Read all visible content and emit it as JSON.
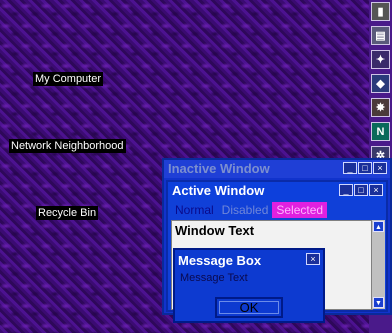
{
  "desktop": {
    "icons": [
      {
        "label": "My Computer"
      },
      {
        "label": "Network Neighborhood"
      },
      {
        "label": "Recycle Bin"
      }
    ]
  },
  "sidebar": {
    "icons": [
      "tool-icon",
      "printer-icon",
      "wizard-icon",
      "package-icon",
      "settings-icon",
      "netscape-icon",
      "gear-icon",
      "cursor-icon"
    ],
    "netscape_letter": "N"
  },
  "inactive_window": {
    "title": "Inactive Window"
  },
  "active_window": {
    "title": "Active Window",
    "menu": {
      "normal": "Normal",
      "disabled": "Disabled",
      "selected": "Selected"
    },
    "window_text": "Window Text"
  },
  "message_box": {
    "title": "Message Box",
    "text": "Message Text",
    "ok_label": "OK"
  },
  "title_buttons": {
    "minimize": "_",
    "maximize": "□",
    "close": "×"
  },
  "colors": {
    "desktop": "#3a0a6e",
    "title_blue": "#0d40dc",
    "selected_magenta": "#e020e0"
  }
}
